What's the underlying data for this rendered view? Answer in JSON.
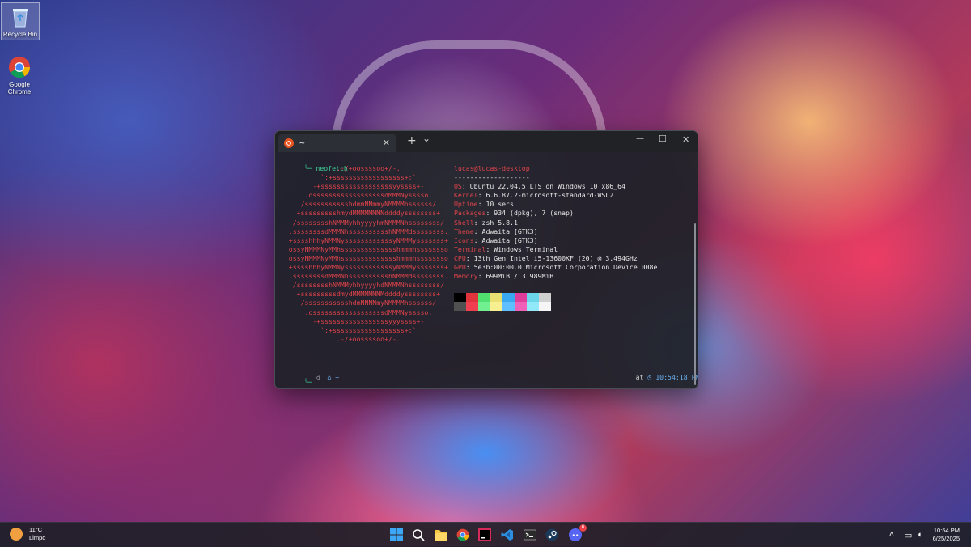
{
  "desktop": {
    "icons": [
      {
        "label": "Recycle Bin"
      },
      {
        "label": "Google Chrome"
      }
    ]
  },
  "terminal": {
    "tab_title": "~",
    "tab_close": "✕",
    "new_tab": "+",
    "dropdown": "⌄",
    "minimize": "—",
    "maximize": "☐",
    "close": "✕",
    "command": "neofetch",
    "art": [
      "               .-/+oossssoo+/-.",
      "           `:+ssssssssssssssssss+:`",
      "         -+ssssssssssssssssssyyssss+-",
      "       .ossssssssssssssssssdMMMNysssso.",
      "      /ssssssssssshdmmNNmmyNMMMMhssssss/",
      "     +ssssssssshmydMMMMMMMNddddyssssssss+",
      "    /sssssssshNMMMyhhyyyyhmNMMMNhssssssss/",
      "   .ssssssssdMMMNhsssssssssshNMMMdssssssss.",
      "   +sssshhhyNMMNyssssssssssssyNMMMysssssss+",
      "   ossyNMMMNyMMhsssssssssssssshmmmhssssssso",
      "   ossyNMMMNyMMhsssssssssssssshmmmhssssssso",
      "   +sssshhhyNMMNyssssssssssssyNMMMysssssss+",
      "   .ssssssssdMMMNhsssssssssshNMMMdssssssss.",
      "    /sssssssshNMMMyhhyyyyhdNMMMNhssssssss/",
      "     +sssssssssdmydMMMMMMMMddddyssssssss+",
      "      /ssssssssssshdmNNNNmyNMMMMhssssss/",
      "       .ossssssssssssssssssdMMMNysssso.",
      "         -+sssssssssssssssssyyyssss+-",
      "           `:+ssssssssssssssssss+:`",
      "               .-/+oossssoo+/-."
    ],
    "user_host": "lucas@lucas-desktop",
    "separator": "-------------------",
    "info": [
      {
        "key": "OS",
        "value": "Ubuntu 22.04.5 LTS on Windows 10 x86_64"
      },
      {
        "key": "Kernel",
        "value": "6.6.87.2-microsoft-standard-WSL2"
      },
      {
        "key": "Uptime",
        "value": "10 secs"
      },
      {
        "key": "Packages",
        "value": "934 (dpkg), 7 (snap)"
      },
      {
        "key": "Shell",
        "value": "zsh 5.8.1"
      },
      {
        "key": "Theme",
        "value": "Adwaita [GTK3]"
      },
      {
        "key": "Icons",
        "value": "Adwaita [GTK3]"
      },
      {
        "key": "Terminal",
        "value": "Windows Terminal"
      },
      {
        "key": "CPU",
        "value": "13th Gen Intel i5-13600KF (20) @ 3.494GHz"
      },
      {
        "key": "GPU",
        "value": "5e3b:00:00.0 Microsoft Corporation Device 008e"
      },
      {
        "key": "Memory",
        "value": "699MiB / 31989MiB"
      }
    ],
    "colors_top": [
      "#000000",
      "#e0343d",
      "#50e070",
      "#e8e070",
      "#3aa8f0",
      "#e03c9a",
      "#6ad6e8",
      "#d0d0d0"
    ],
    "colors_bottom": [
      "#505050",
      "#f04050",
      "#70f090",
      "#f8f090",
      "#60c0ff",
      "#f060b8",
      "#90e8f8",
      "#f5f5f5"
    ],
    "prompt_path": "~",
    "prompt_at": "at",
    "prompt_time": "10:54:18 PM"
  },
  "taskbar": {
    "weather_temp": "11°C",
    "weather_desc": "Limpo",
    "clock_time": "10:54 PM",
    "clock_date": "6/25/2025",
    "discord_badge": "6"
  }
}
